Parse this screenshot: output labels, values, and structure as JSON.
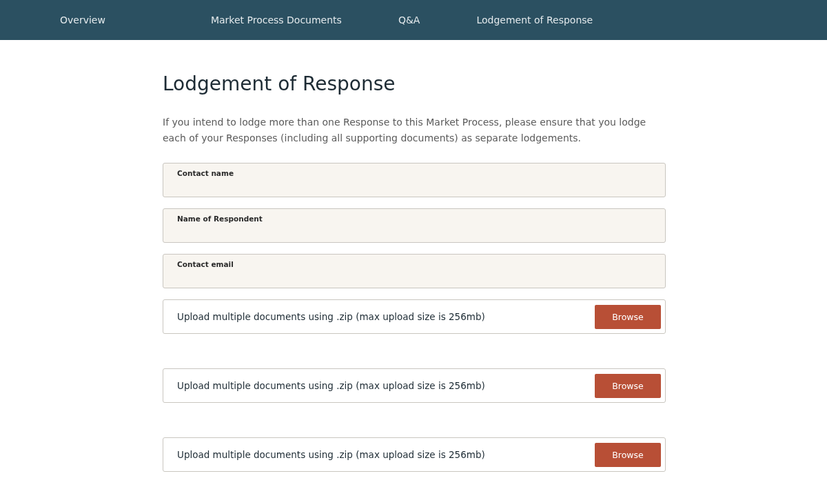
{
  "nav": {
    "items": [
      {
        "label": "Overview"
      },
      {
        "label": "Market Process Documents"
      },
      {
        "label": "Q&A"
      },
      {
        "label": "Lodgement of Response"
      }
    ]
  },
  "page": {
    "title": "Lodgement of Response",
    "intro": "If you intend to lodge more than one Response to this Market Process, please ensure that you lodge each of your Responses (including all supporting documents) as separate lodgements."
  },
  "fields": [
    {
      "label": "Contact name"
    },
    {
      "label": "Name of Respondent"
    },
    {
      "label": "Contact email"
    }
  ],
  "uploads": [
    {
      "text": "Upload multiple documents using .zip (max upload size is 256mb)",
      "button": "Browse"
    },
    {
      "text": "Upload multiple documents using .zip (max upload size is 256mb)",
      "button": "Browse"
    },
    {
      "text": "Upload multiple documents using .zip (max upload size is 256mb)",
      "button": "Browse"
    }
  ]
}
